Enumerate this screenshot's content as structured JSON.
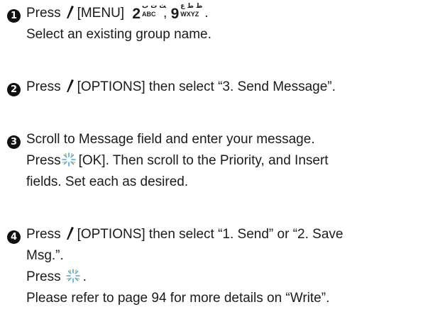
{
  "steps": [
    {
      "number": "1",
      "lines": [
        {
          "press": "Press",
          "menu": "[MENU]",
          "key1_digit": "2",
          "key1_top": "ﺚ ﺕ ﺏ",
          "key1_bottom": "ABC",
          "comma": ",",
          "key2_digit": "9",
          "key2_top": "ﻅ ﻁ ﻉ",
          "key2_bottom": "WXYZ",
          "period": "."
        },
        {
          "text": "Select an existing group name."
        }
      ]
    },
    {
      "number": "2",
      "lines": [
        {
          "press": "Press",
          "rest": "[OPTIONS] then select “3. Send Message”."
        }
      ]
    },
    {
      "number": "3",
      "lines": [
        {
          "text": "Scroll to Message field and enter your message."
        },
        {
          "press": "Press",
          "rest": "[OK]. Then scroll to the Priority, and Insert"
        },
        {
          "text": "fields. Set each as desired."
        }
      ]
    },
    {
      "number": "4",
      "lines": [
        {
          "press": "Press",
          "rest": "[OPTIONS] then select “1. Send” or “2. Save"
        },
        {
          "text": "Msg.”."
        },
        {
          "press": "Press",
          "rest": "."
        },
        {
          "text": "Please refer to page 94 for more details on “Write”."
        }
      ]
    }
  ],
  "icons": {
    "soft_key": "pen-slash-icon",
    "ok_key": "sparkle-burst-icon",
    "colors": {
      "soft_key": "#111111",
      "ok_key": "#4aa8d8",
      "text": "#1b1b1b"
    }
  }
}
